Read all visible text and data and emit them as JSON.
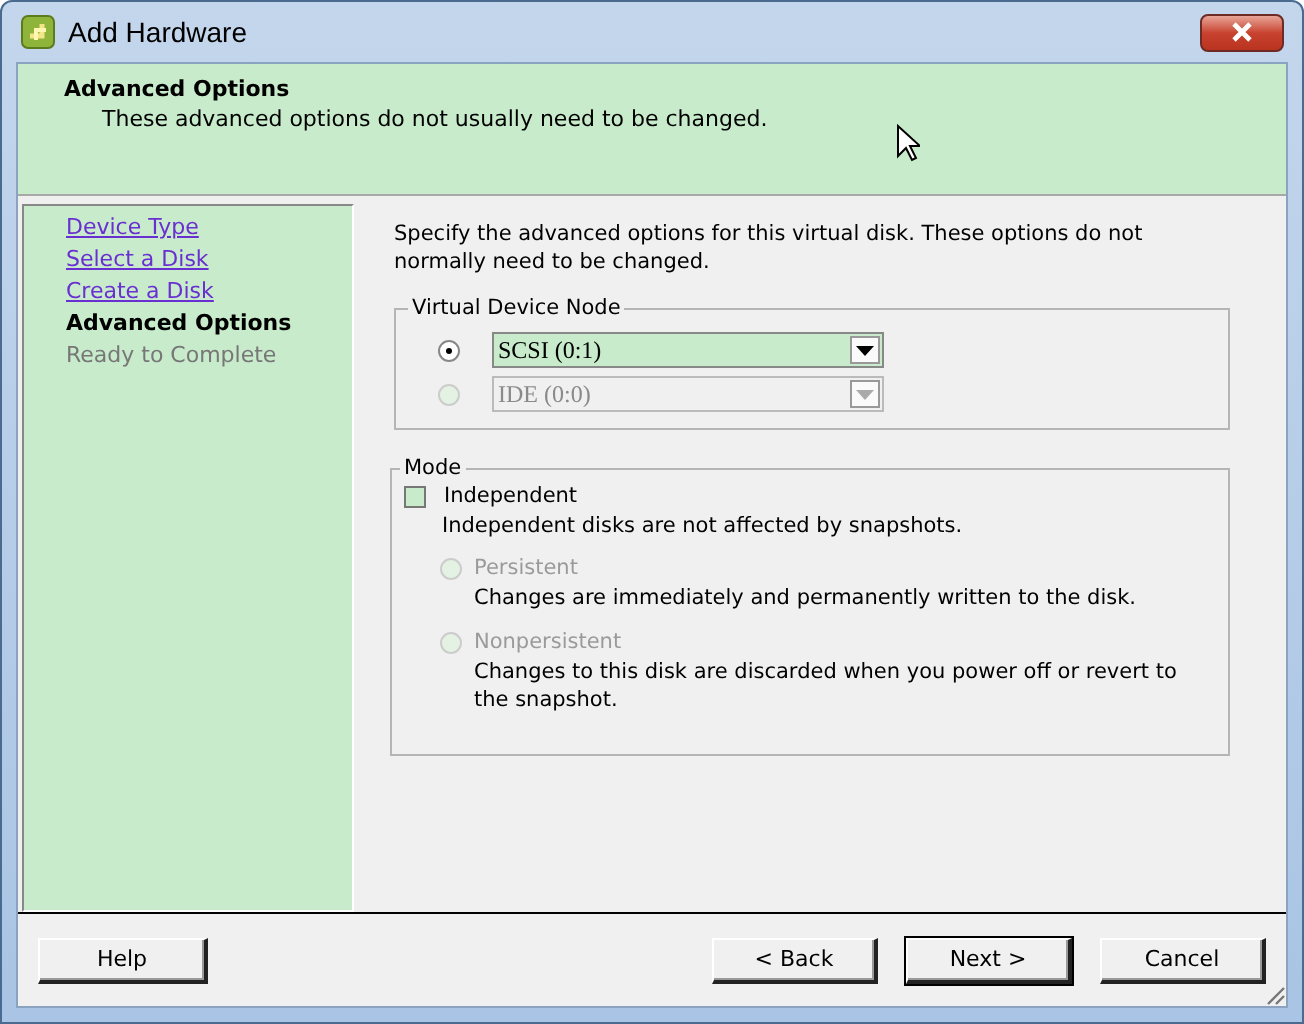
{
  "window": {
    "title": "Add Hardware"
  },
  "header": {
    "title": "Advanced Options",
    "subtitle": "These advanced options do not usually need to be changed."
  },
  "steps": [
    {
      "label": "Device Type",
      "kind": "link"
    },
    {
      "label": "Select a Disk",
      "kind": "link"
    },
    {
      "label": "Create a Disk",
      "kind": "link"
    },
    {
      "label": "Advanced Options",
      "kind": "current"
    },
    {
      "label": "Ready to Complete",
      "kind": "pending"
    }
  ],
  "intro": "Specify the advanced options for this virtual disk. These options do not normally need to be changed.",
  "device_node": {
    "legend": "Virtual Device Node",
    "options": [
      {
        "value": "SCSI (0:1)",
        "selected": true,
        "disabled": false
      },
      {
        "value": "IDE (0:0)",
        "selected": false,
        "disabled": true
      }
    ]
  },
  "mode": {
    "legend": "Mode",
    "independent": {
      "label": "Independent",
      "checked": false
    },
    "note": "Independent disks are not affected by snapshots.",
    "options": [
      {
        "label": "Persistent",
        "selected": false,
        "disabled": true,
        "description": "Changes are immediately and permanently written to the disk."
      },
      {
        "label": "Nonpersistent",
        "selected": false,
        "disabled": true,
        "description": "Changes to this disk are discarded when you power off or revert to the snapshot."
      }
    ]
  },
  "buttons": {
    "help": "Help",
    "back": "< Back",
    "next": "Next >",
    "cancel": "Cancel"
  }
}
